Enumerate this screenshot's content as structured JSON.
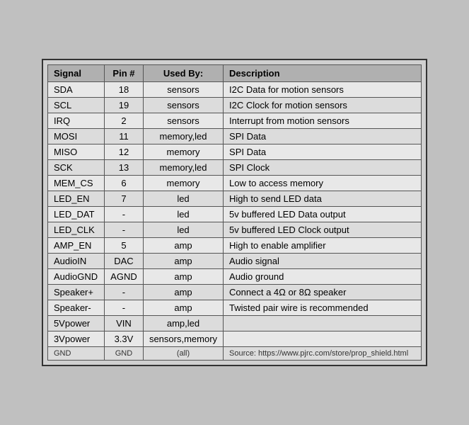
{
  "table": {
    "headers": [
      "Signal",
      "Pin #",
      "Used By:",
      "Description"
    ],
    "rows": [
      {
        "signal": "SDA",
        "pin": "18",
        "usedby": "sensors",
        "description": "I2C Data for motion sensors"
      },
      {
        "signal": "SCL",
        "pin": "19",
        "usedby": "sensors",
        "description": "I2C Clock for motion sensors"
      },
      {
        "signal": "IRQ",
        "pin": "2",
        "usedby": "sensors",
        "description": "Interrupt from motion sensors"
      },
      {
        "signal": "MOSI",
        "pin": "11",
        "usedby": "memory,led",
        "description": "SPI Data"
      },
      {
        "signal": "MISO",
        "pin": "12",
        "usedby": "memory",
        "description": "SPI Data"
      },
      {
        "signal": "SCK",
        "pin": "13",
        "usedby": "memory,led",
        "description": "SPI Clock"
      },
      {
        "signal": "MEM_CS",
        "pin": "6",
        "usedby": "memory",
        "description": "Low to access memory"
      },
      {
        "signal": "LED_EN",
        "pin": "7",
        "usedby": "led",
        "description": "High to send LED data"
      },
      {
        "signal": "LED_DAT",
        "pin": "-",
        "usedby": "led",
        "description": "5v buffered LED Data output"
      },
      {
        "signal": "LED_CLK",
        "pin": "-",
        "usedby": "led",
        "description": "5v buffered LED Clock output"
      },
      {
        "signal": "AMP_EN",
        "pin": "5",
        "usedby": "amp",
        "description": "High to enable amplifier"
      },
      {
        "signal": "AudioIN",
        "pin": "DAC",
        "usedby": "amp",
        "description": "Audio signal"
      },
      {
        "signal": "AudioGND",
        "pin": "AGND",
        "usedby": "amp",
        "description": "Audio ground"
      },
      {
        "signal": "Speaker+",
        "pin": "-",
        "usedby": "amp",
        "description": "Connect a 4Ω or 8Ω speaker"
      },
      {
        "signal": "Speaker-",
        "pin": "-",
        "usedby": "amp",
        "description": "Twisted pair wire is recommended"
      },
      {
        "signal": "5Vpower",
        "pin": "VIN",
        "usedby": "amp,led",
        "description": ""
      },
      {
        "signal": "3Vpower",
        "pin": "3.3V",
        "usedby": "sensors,memory",
        "description": ""
      },
      {
        "signal": "GND",
        "pin": "GND",
        "usedby": "(all)",
        "description": "Source: https://www.pjrc.com/store/prop_shield.html"
      }
    ]
  }
}
